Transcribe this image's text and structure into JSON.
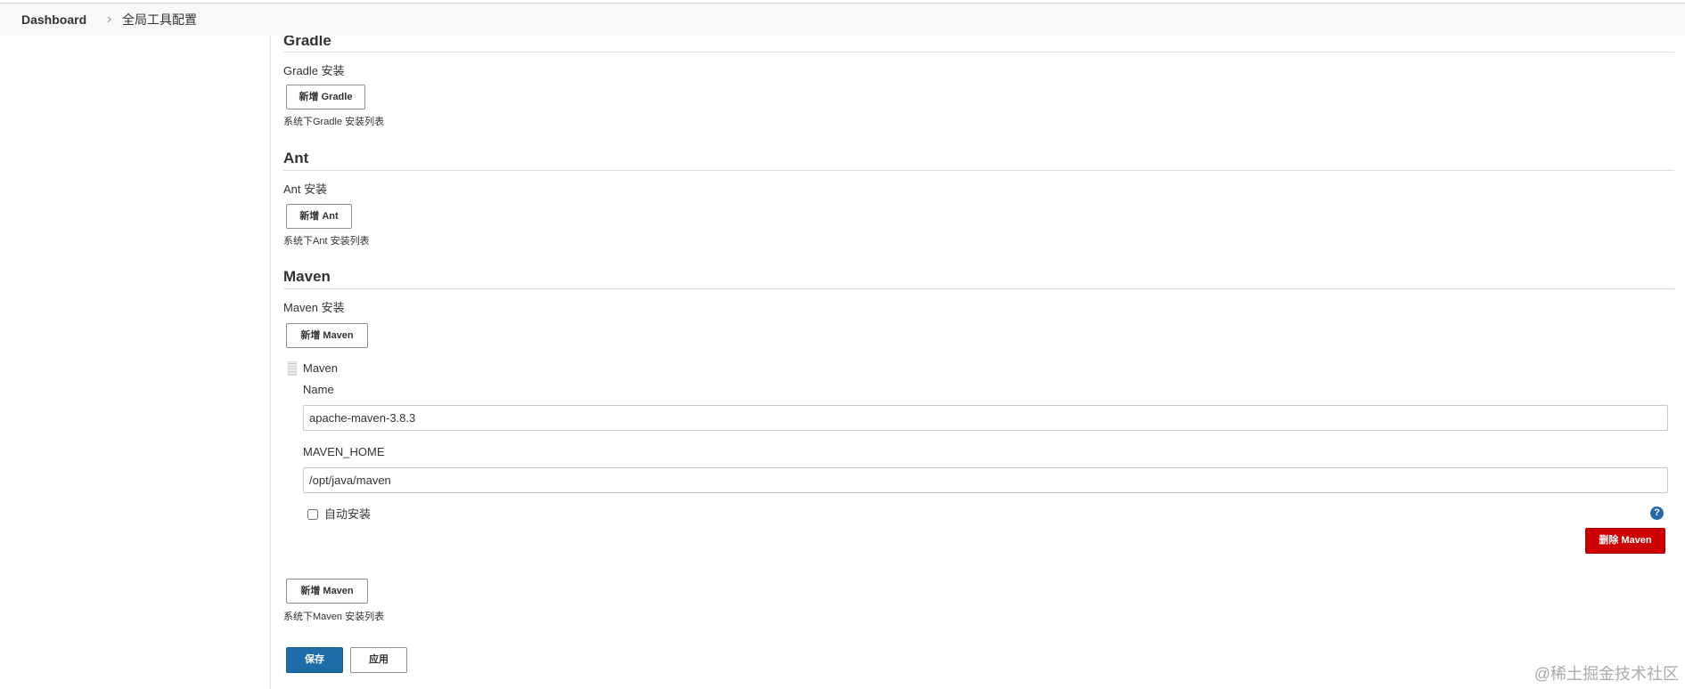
{
  "breadcrumb": {
    "home": "Dashboard",
    "current": "全局工具配置",
    "separator_icon": "chevron-right-icon"
  },
  "gradle": {
    "title": "Gradle",
    "install_label": "Gradle 安装",
    "add_button": "新增 Gradle",
    "hint": "系统下Gradle 安装列表"
  },
  "ant": {
    "title": "Ant",
    "install_label": "Ant 安装",
    "add_button": "新增 Ant",
    "hint": "系统下Ant 安装列表"
  },
  "maven": {
    "title": "Maven",
    "install_label": "Maven 安装",
    "add_button_top": "新增 Maven",
    "installations": [
      {
        "header": "Maven",
        "drag_handle_icon": "drag-handle-icon",
        "name": {
          "label": "Name",
          "value": "apache-maven-3.8.3"
        },
        "home": {
          "label": "MAVEN_HOME",
          "value": "/opt/java/maven"
        },
        "auto_install": {
          "label": "自动安装",
          "checked": false
        },
        "help_icon": {
          "name": "help-icon",
          "glyph": "?"
        },
        "delete_button": "删除 Maven"
      }
    ],
    "add_button_bottom": "新增 Maven",
    "hint": "系统下Maven 安装列表"
  },
  "actions": {
    "save": "保存",
    "apply": "应用"
  },
  "watermark": "@稀土掘金技术社区",
  "colors": {
    "primary": "#1f6da8",
    "danger": "#cc0000",
    "help": "#2369a8",
    "text": "#333333",
    "watermark": "#aaaaaa"
  }
}
